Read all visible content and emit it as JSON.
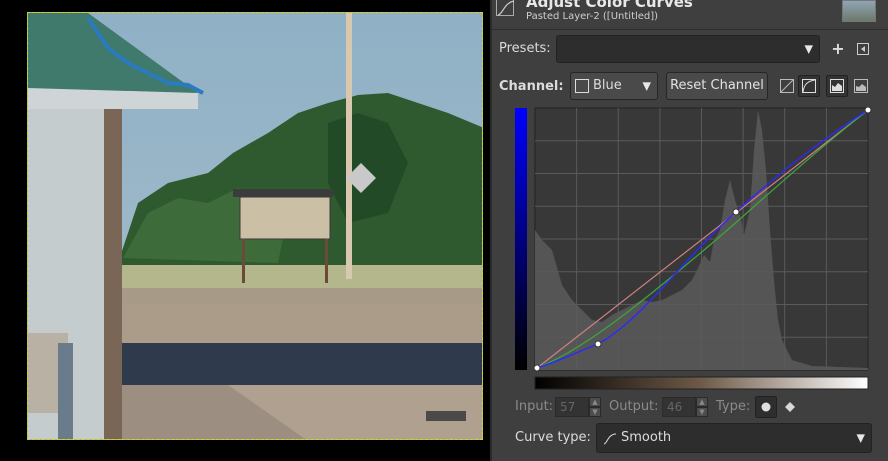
{
  "dialog": {
    "title": "Adjust Color Curves",
    "subtitle": "Pasted Layer-2 ([Untitled])",
    "icon": "curves-icon"
  },
  "presets": {
    "label": "Presets:",
    "value": ""
  },
  "channel": {
    "label": "Channel:",
    "value": "Blue",
    "reset_label": "Reset Channel"
  },
  "point": {
    "input_label": "Input:",
    "input_value": "57",
    "output_label": "Output:",
    "output_value": "46",
    "type_label": "Type:"
  },
  "curve_type": {
    "label": "Curve type:",
    "value": "Smooth"
  },
  "colors": {
    "curve_blue": "#2a2aff",
    "curve_green": "#3aa83a",
    "curve_red": "#d08080",
    "canvas_marquee": "#d8d800"
  }
}
